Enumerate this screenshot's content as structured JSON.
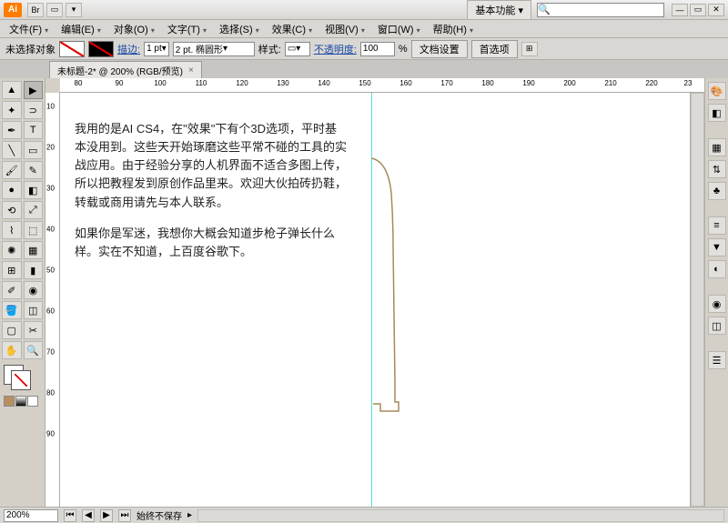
{
  "titlebar": {
    "workspace": "基本功能",
    "search_placeholder": ""
  },
  "menu": {
    "file": "文件(F)",
    "edit": "编辑(E)",
    "object": "对象(O)",
    "type": "文字(T)",
    "select": "选择(S)",
    "effect": "效果(C)",
    "view": "视图(V)",
    "window": "窗口(W)",
    "help": "帮助(H)"
  },
  "optbar": {
    "noselect": "未选择对象",
    "stroke_label": "描边:",
    "stroke_weight": "1 pt",
    "brush": "2 pt. 椭圆形",
    "style_label": "样式:",
    "opacity_label": "不透明度:",
    "opacity_value": "100",
    "percent": "%",
    "docsetup": "文档设置",
    "prefs": "首选项"
  },
  "doctab": {
    "title": "未标题-2* @ 200% (RGB/预览)"
  },
  "ruler_h": [
    "80",
    "90",
    "100",
    "110",
    "120",
    "130",
    "140",
    "150",
    "160",
    "170",
    "180",
    "190",
    "200",
    "210",
    "220",
    "23"
  ],
  "ruler_v": [
    "10",
    "20",
    "30",
    "40",
    "50",
    "60",
    "70",
    "80",
    "90"
  ],
  "canvas": {
    "para1": "我用的是AI CS4，在\"效果\"下有个3D选项，平时基本没用到。这些天开始琢磨这些平常不碰的工具的实战应用。由于经验分享的人机界面不适合多图上传，所以把教程发到原创作品里来。欢迎大伙拍砖扔鞋，转载或商用请先与本人联系。",
    "para2": "如果你是军迷，我想你大概会知道步枪子弹长什么样。实在不知道，上百度谷歌下。"
  },
  "statusbar": {
    "zoom": "200%",
    "autosave": "始终不保存"
  },
  "chart_data": null
}
